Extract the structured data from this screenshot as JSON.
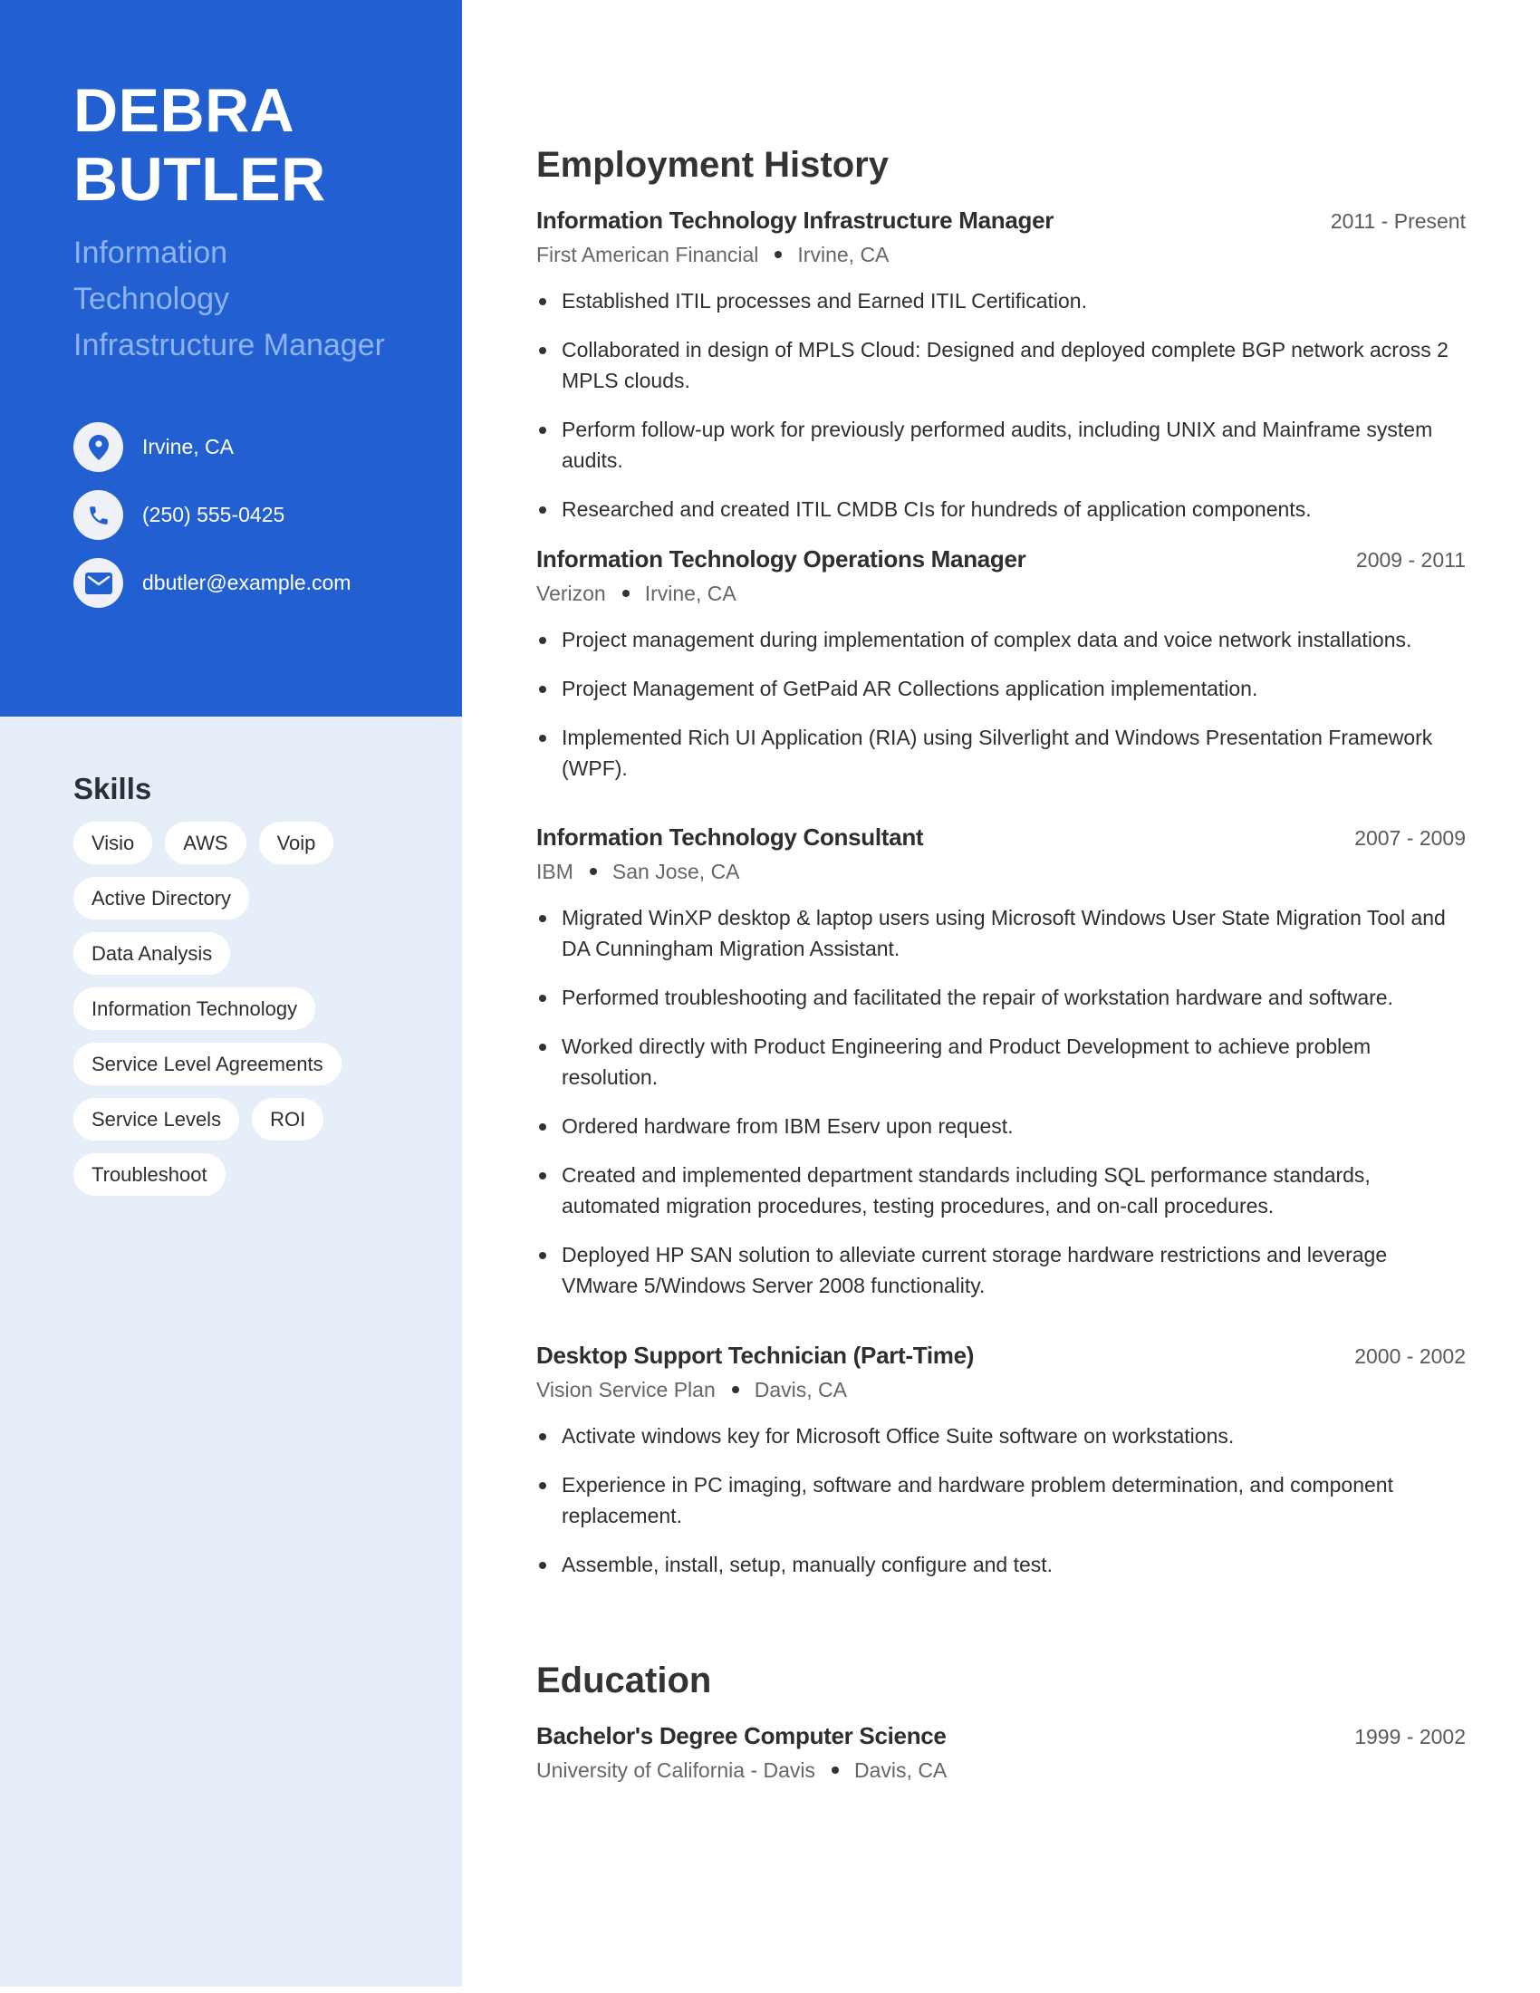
{
  "profile": {
    "first_name": "DEBRA",
    "last_name": "BUTLER",
    "title_lines": [
      "Information",
      "Technology",
      "Infrastructure Manager"
    ]
  },
  "contact": [
    {
      "icon": "location-pin-icon",
      "text": "Irvine, CA"
    },
    {
      "icon": "phone-icon",
      "text": "(250) 555-0425"
    },
    {
      "icon": "envelope-icon",
      "text": "dbutler@example.com"
    }
  ],
  "skills": {
    "title": "Skills",
    "items": [
      "Visio",
      "AWS",
      "Voip",
      "Active Directory",
      "Data Analysis",
      "Information Technology",
      "Service Level Agreements",
      "Service Levels",
      "ROI",
      "Troubleshoot"
    ]
  },
  "employment": {
    "title": "Employment History",
    "jobs": [
      {
        "title": "Information Technology Infrastructure Manager",
        "dates": "2011 - Present",
        "company": "First American Financial",
        "location": "Irvine, CA",
        "bullets": [
          "Established ITIL processes and Earned ITIL Certification.",
          "Collaborated in design of MPLS Cloud: Designed and deployed complete BGP network across 2 MPLS clouds.",
          "Perform follow-up work for previously performed audits, including UNIX and Mainframe system audits.",
          "Researched and created ITIL CMDB CIs for hundreds of application components."
        ]
      },
      {
        "title": "Information Technology Operations Manager",
        "dates": "2009 - 2011",
        "company": "Verizon",
        "location": "Irvine, CA",
        "bullets": [
          "Project management during implementation of complex data and voice network installations.",
          "Project Management of GetPaid AR Collections application implementation.",
          "Implemented Rich UI Application (RIA) using Silverlight and Windows Presentation Framework (WPF)."
        ]
      },
      {
        "title": "Information Technology Consultant",
        "dates": "2007 - 2009",
        "company": "IBM",
        "location": "San Jose, CA",
        "bullets": [
          "Migrated WinXP desktop & laptop users using Microsoft Windows User State Migration Tool and DA Cunningham Migration Assistant.",
          "Performed troubleshooting and facilitated the repair of workstation hardware and software.",
          "Worked directly with Product Engineering and Product Development to achieve problem resolution.",
          "Ordered hardware from IBM Eserv upon request.",
          "Created and implemented department standards including SQL performance standards, automated migration procedures, testing procedures, and on-call procedures.",
          "Deployed HP SAN solution to alleviate current storage hardware restrictions and leverage VMware 5/Windows Server 2008 functionality."
        ]
      },
      {
        "title": "Desktop Support Technician (Part-Time)",
        "dates": "2000 - 2002",
        "company": "Vision Service Plan",
        "location": "Davis, CA",
        "bullets": [
          "Activate windows key for Microsoft Office Suite software on workstations.",
          "Experience in PC imaging, software and hardware problem determination, and component replacement.",
          "Assemble, install, setup, manually configure and test."
        ]
      }
    ]
  },
  "education": {
    "title": "Education",
    "entries": [
      {
        "degree": "Bachelor's Degree Computer Science",
        "dates": "1999 - 2002",
        "school": "University of California - Davis",
        "location": "Davis, CA"
      }
    ]
  },
  "colors": {
    "accent": "#2260d2",
    "sidebar_bg": "#e6eefa",
    "subtitle": "#8fb3f0"
  }
}
